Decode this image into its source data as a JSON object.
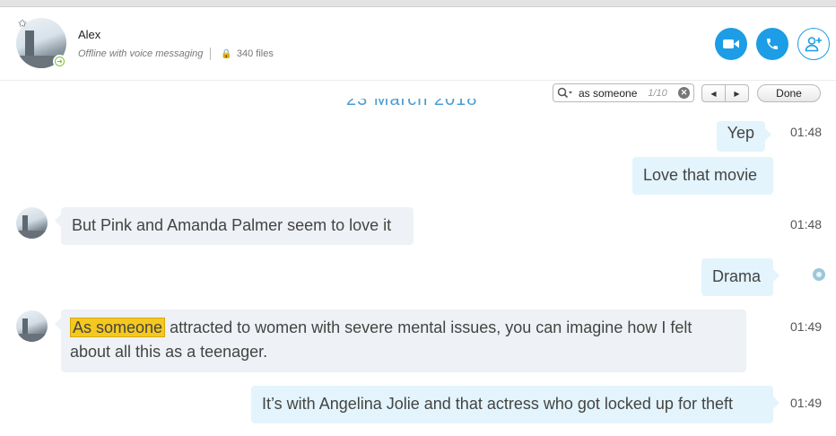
{
  "header": {
    "contact_name": "Alex",
    "status": "Offline with voice messaging",
    "files": "340 files"
  },
  "search": {
    "query": "as someone",
    "count": "1/10",
    "done_label": "Done"
  },
  "date_fragment": "23 March 2018",
  "messages": [
    {
      "dir": "out",
      "text": "Yep",
      "time": "01:48"
    },
    {
      "dir": "out",
      "text": "Love that movie",
      "time": ""
    },
    {
      "dir": "in",
      "text": "But Pink and Amanda Palmer seem to love it",
      "time": "01:48"
    },
    {
      "dir": "out",
      "text": "Drama",
      "time": ""
    },
    {
      "dir": "in",
      "highlight": "As someone",
      "text": "attracted to women with severe mental issues, you can imagine how I felt",
      "text_line2": "about all this as a teenager.",
      "time": "01:49"
    },
    {
      "dir": "out",
      "text": "It’s with Angelina Jolie and that actress who got locked up for theft",
      "time": "01:49"
    }
  ],
  "colors": {
    "accent": "#1c9de6",
    "outgoing_bubble": "#e3f4fc",
    "incoming_bubble": "#eef1f5",
    "highlight": "#f5c81f"
  }
}
